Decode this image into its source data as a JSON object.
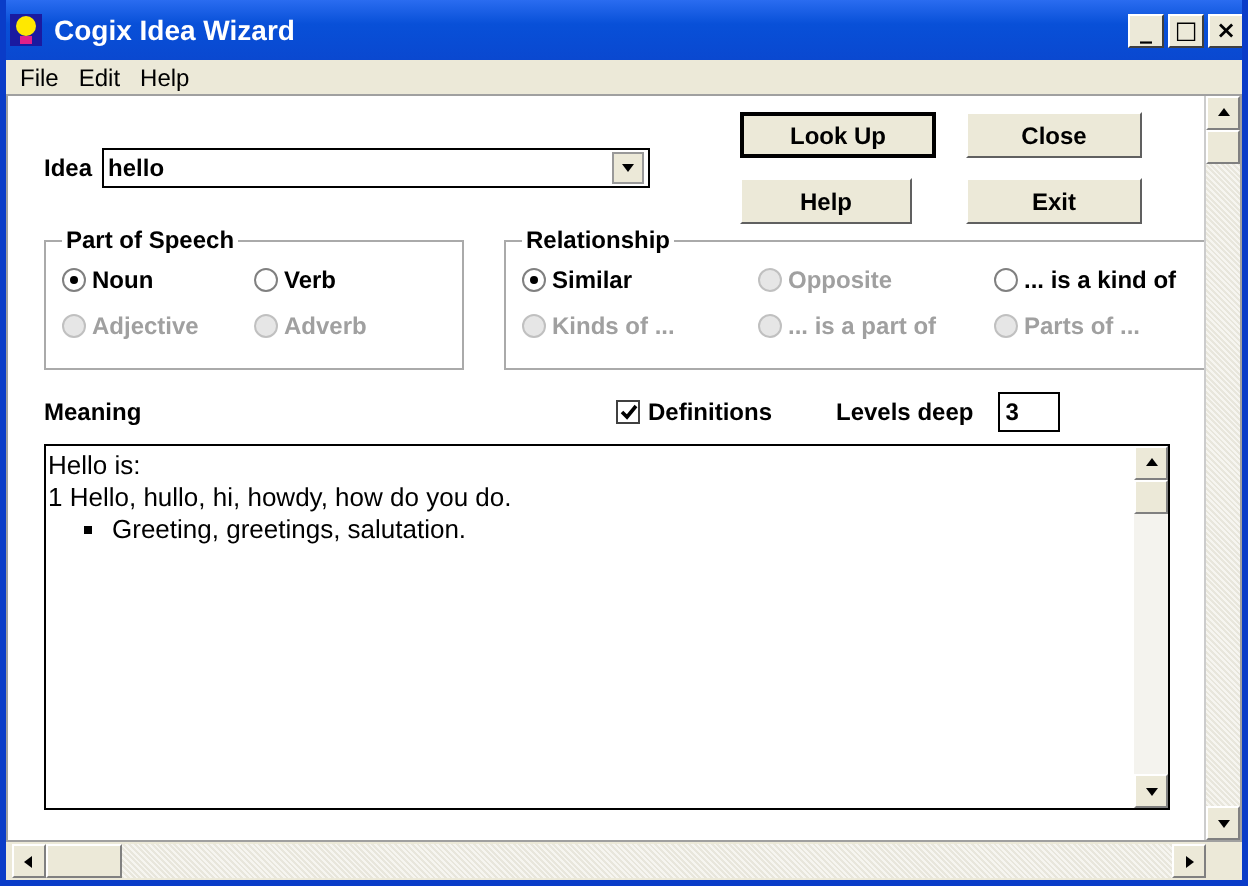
{
  "window": {
    "title": "Cogix Idea Wizard",
    "controls": [
      "_",
      "□",
      "×"
    ]
  },
  "menu": [
    "File",
    "Edit",
    "Help"
  ],
  "idea": {
    "label": "Idea",
    "value": "hello"
  },
  "buttons": [
    {
      "label": "Look Up",
      "default": true
    },
    {
      "label": "Close",
      "default": false
    },
    {
      "label": "Help",
      "default": false
    },
    {
      "label": "Exit",
      "default": false
    }
  ],
  "part_of_speech": {
    "title": "Part of Speech",
    "options": [
      {
        "label": "Noun",
        "selected": true,
        "disabled": false
      },
      {
        "label": "Verb",
        "selected": false,
        "disabled": false
      },
      {
        "label": "Adjective",
        "selected": false,
        "disabled": true
      },
      {
        "label": "Adverb",
        "selected": false,
        "disabled": true
      }
    ]
  },
  "relationship": {
    "title": "Relationship",
    "options": [
      {
        "label": "Similar",
        "selected": true,
        "disabled": false
      },
      {
        "label": "Opposite",
        "selected": false,
        "disabled": true
      },
      {
        "label": "... is a kind of",
        "selected": false,
        "disabled": false
      },
      {
        "label": "Kinds of ...",
        "selected": false,
        "disabled": true
      },
      {
        "label": "... is a part of",
        "selected": false,
        "disabled": true
      },
      {
        "label": "Parts of ...",
        "selected": false,
        "disabled": true
      }
    ]
  },
  "meaning": {
    "label": "Meaning",
    "definitions": {
      "label": "Definitions",
      "checked": true
    },
    "levels": {
      "label": "Levels deep",
      "value": "3"
    },
    "lines": [
      {
        "kind": "plain",
        "text": "Hello is:"
      },
      {
        "kind": "plain",
        "text": "1 Hello, hullo, hi, howdy, how do you do."
      },
      {
        "kind": "bullet",
        "text": "Greeting, greetings, salutation."
      }
    ]
  }
}
